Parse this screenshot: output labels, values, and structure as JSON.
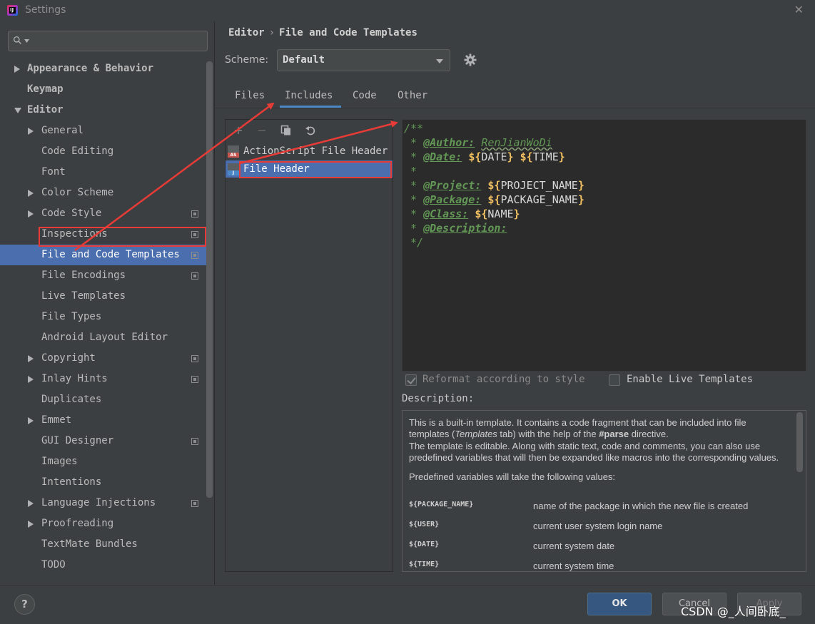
{
  "window": {
    "title": "Settings",
    "app_icon": "intellij-logo-icon",
    "close_glyph": "✕"
  },
  "search": {
    "placeholder": "",
    "value": "",
    "icon": "search-icon"
  },
  "sidebar": {
    "items": [
      {
        "label": "Appearance & Behavior",
        "bold": true,
        "arrow": "right",
        "indent": 0,
        "copy": false
      },
      {
        "label": "Keymap",
        "bold": true,
        "arrow": "",
        "indent": 0,
        "copy": false
      },
      {
        "label": "Editor",
        "bold": true,
        "arrow": "down",
        "indent": 0,
        "copy": false
      },
      {
        "label": "General",
        "bold": false,
        "arrow": "right",
        "indent": 1,
        "copy": false
      },
      {
        "label": "Code Editing",
        "bold": false,
        "arrow": "",
        "indent": 1,
        "copy": false
      },
      {
        "label": "Font",
        "bold": false,
        "arrow": "",
        "indent": 1,
        "copy": false
      },
      {
        "label": "Color Scheme",
        "bold": false,
        "arrow": "right",
        "indent": 1,
        "copy": false
      },
      {
        "label": "Code Style",
        "bold": false,
        "arrow": "right",
        "indent": 1,
        "copy": true
      },
      {
        "label": "Inspections",
        "bold": false,
        "arrow": "",
        "indent": 1,
        "copy": true
      },
      {
        "label": "File and Code Templates",
        "bold": false,
        "arrow": "",
        "indent": 1,
        "copy": true,
        "selected": true
      },
      {
        "label": "File Encodings",
        "bold": false,
        "arrow": "",
        "indent": 1,
        "copy": true
      },
      {
        "label": "Live Templates",
        "bold": false,
        "arrow": "",
        "indent": 1,
        "copy": false
      },
      {
        "label": "File Types",
        "bold": false,
        "arrow": "",
        "indent": 1,
        "copy": false
      },
      {
        "label": "Android Layout Editor",
        "bold": false,
        "arrow": "",
        "indent": 1,
        "copy": false
      },
      {
        "label": "Copyright",
        "bold": false,
        "arrow": "right",
        "indent": 1,
        "copy": true
      },
      {
        "label": "Inlay Hints",
        "bold": false,
        "arrow": "right",
        "indent": 1,
        "copy": true
      },
      {
        "label": "Duplicates",
        "bold": false,
        "arrow": "",
        "indent": 1,
        "copy": false
      },
      {
        "label": "Emmet",
        "bold": false,
        "arrow": "right",
        "indent": 1,
        "copy": false
      },
      {
        "label": "GUI Designer",
        "bold": false,
        "arrow": "",
        "indent": 1,
        "copy": true
      },
      {
        "label": "Images",
        "bold": false,
        "arrow": "",
        "indent": 1,
        "copy": false
      },
      {
        "label": "Intentions",
        "bold": false,
        "arrow": "",
        "indent": 1,
        "copy": false
      },
      {
        "label": "Language Injections",
        "bold": false,
        "arrow": "right",
        "indent": 1,
        "copy": true
      },
      {
        "label": "Proofreading",
        "bold": false,
        "arrow": "right",
        "indent": 1,
        "copy": false
      },
      {
        "label": "TextMate Bundles",
        "bold": false,
        "arrow": "",
        "indent": 1,
        "copy": false
      },
      {
        "label": "TODO",
        "bold": false,
        "arrow": "",
        "indent": 1,
        "copy": false
      }
    ]
  },
  "header": {
    "breadcrumb_parent": "Editor",
    "breadcrumb_sep": "›",
    "breadcrumb_current": "File and Code Templates"
  },
  "scheme": {
    "label": "Scheme:",
    "value": "Default",
    "gear_icon": "gear-icon"
  },
  "tabs": [
    {
      "label": "Files",
      "active": false
    },
    {
      "label": "Includes",
      "active": true
    },
    {
      "label": "Code",
      "active": false
    },
    {
      "label": "Other",
      "active": false
    }
  ],
  "template_list": {
    "toolbar": [
      "add-icon",
      "remove-icon",
      "copy-icon",
      "reset-icon"
    ],
    "items": [
      {
        "label": "ActionScript File Header",
        "badge": "AS",
        "badge_color": "#c75450",
        "selected": false
      },
      {
        "label": "File Header",
        "badge": "J",
        "badge_color": "#4a88c7",
        "selected": true
      }
    ]
  },
  "editor": {
    "lines": [
      {
        "parts": [
          {
            "t": "/**",
            "c": "c-com"
          }
        ]
      },
      {
        "parts": [
          {
            "t": " * ",
            "c": "c-com"
          },
          {
            "t": "@Author:",
            "c": "c-tag"
          },
          {
            "t": " ",
            "c": "c-com"
          },
          {
            "t": "RenJianWoDi",
            "c": "c-val c-squiggle"
          }
        ]
      },
      {
        "parts": [
          {
            "t": " * ",
            "c": "c-com"
          },
          {
            "t": "@Date:",
            "c": "c-tag"
          },
          {
            "t": " ",
            "c": "c-com"
          },
          {
            "t": "${",
            "c": "c-dollar"
          },
          {
            "t": "DATE",
            "c": "c-var"
          },
          {
            "t": "}",
            "c": "c-dollar"
          },
          {
            "t": " ",
            "c": "c-com"
          },
          {
            "t": "${",
            "c": "c-dollar"
          },
          {
            "t": "TIME",
            "c": "c-var"
          },
          {
            "t": "}",
            "c": "c-dollar"
          }
        ]
      },
      {
        "parts": [
          {
            "t": " *",
            "c": "c-com"
          }
        ]
      },
      {
        "parts": [
          {
            "t": " * ",
            "c": "c-com"
          },
          {
            "t": "@Project:",
            "c": "c-tag"
          },
          {
            "t": " ",
            "c": "c-com"
          },
          {
            "t": "${",
            "c": "c-dollar"
          },
          {
            "t": "PROJECT_NAME",
            "c": "c-var"
          },
          {
            "t": "}",
            "c": "c-dollar"
          }
        ]
      },
      {
        "parts": [
          {
            "t": " * ",
            "c": "c-com"
          },
          {
            "t": "@Package:",
            "c": "c-tag"
          },
          {
            "t": " ",
            "c": "c-com"
          },
          {
            "t": "${",
            "c": "c-dollar"
          },
          {
            "t": "PACKAGE_NAME",
            "c": "c-var"
          },
          {
            "t": "}",
            "c": "c-dollar"
          }
        ]
      },
      {
        "parts": [
          {
            "t": " * ",
            "c": "c-com"
          },
          {
            "t": "@Class:",
            "c": "c-tag"
          },
          {
            "t": " ",
            "c": "c-com"
          },
          {
            "t": "${",
            "c": "c-dollar"
          },
          {
            "t": "NAME",
            "c": "c-var"
          },
          {
            "t": "}",
            "c": "c-dollar"
          }
        ]
      },
      {
        "parts": [
          {
            "t": " * ",
            "c": "c-com"
          },
          {
            "t": "@Description:",
            "c": "c-tag"
          }
        ]
      },
      {
        "parts": [
          {
            "t": " */",
            "c": "c-com"
          }
        ]
      }
    ]
  },
  "options": {
    "reformat": {
      "label": "Reformat according to style",
      "checked": true,
      "enabled": false
    },
    "live_templates": {
      "label": "Enable Live Templates",
      "checked": false,
      "enabled": true
    }
  },
  "description": {
    "label": "Description:",
    "p1_a": "This is a built-in template. It contains a code fragment that can be included into file templates (",
    "p1_em": "Templates",
    "p1_b": " tab) with the help of the ",
    "p1_strong": "#parse",
    "p1_c": " directive.",
    "p2": "The template is editable. Along with static text, code and comments, you can also use predefined variables that will then be expanded like macros into the corresponding values.",
    "p3": "Predefined variables will take the following values:",
    "vars": [
      {
        "name": "${PACKAGE_NAME}",
        "desc": "name of the package in which the new file is created"
      },
      {
        "name": "${USER}",
        "desc": "current user system login name"
      },
      {
        "name": "${DATE}",
        "desc": "current system date"
      },
      {
        "name": "${TIME}",
        "desc": "current system time"
      }
    ]
  },
  "footer": {
    "help": "?",
    "ok": "OK",
    "cancel": "Cancel",
    "apply": "Apply",
    "watermark": "CSDN @_人间卧底_"
  },
  "annotations": {
    "color": "#e63b36"
  }
}
